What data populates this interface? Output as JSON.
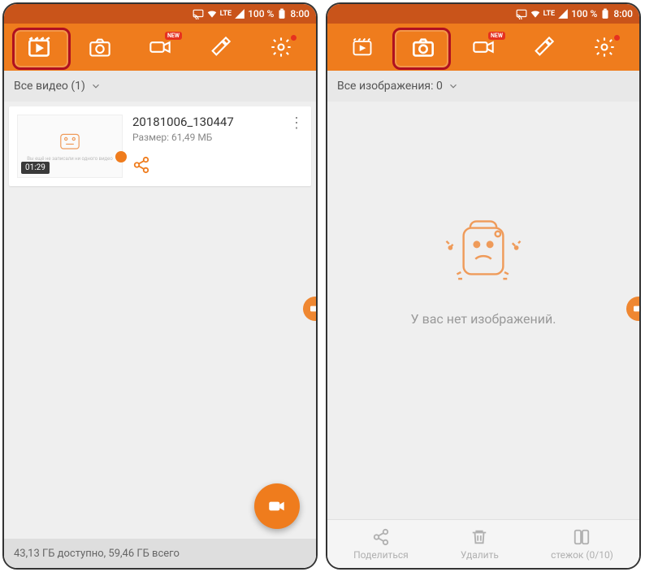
{
  "status": {
    "network": "LTE",
    "battery": "100 %",
    "time": "8:00"
  },
  "toolbar": {
    "video_icon": "video-library",
    "camera_icon": "camera",
    "live_icon": "live",
    "tools_icon": "tools",
    "settings_icon": "settings",
    "new_badge": "NEW"
  },
  "left": {
    "filter_label": "Все видео (1)",
    "video": {
      "title": "20181006_130447",
      "size_label": "Размер: 61,49 МБ",
      "duration": "01:29",
      "thumb_text": "Вы ещё не записали ни одного видео"
    },
    "storage_text": "43,13 ГБ доступно, 59,46 ГБ всего"
  },
  "right": {
    "filter_label": "Все изображения: 0",
    "empty_text": "У вас нет изображений.",
    "actions": {
      "share": "Поделиться",
      "delete": "Удалить",
      "stitch": "стежок (0/10)"
    }
  }
}
